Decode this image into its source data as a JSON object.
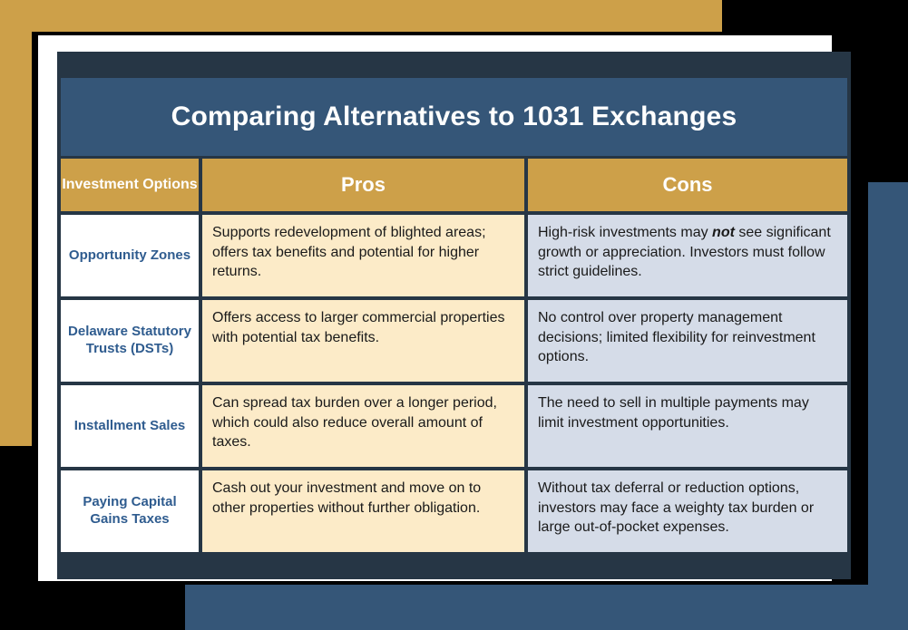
{
  "colors": {
    "gold": "#CDA049",
    "title_blue": "#355678",
    "frame_navy": "#263645",
    "pros_bg": "#FCEBC8",
    "cons_bg": "#D5DCE8",
    "option_text": "#2F5C8F",
    "card_white": "#FFFFFF"
  },
  "title": "Comparing Alternatives to 1031 Exchanges",
  "columns": {
    "option": "Investment Options",
    "pros": "Pros",
    "cons": "Cons"
  },
  "rows": [
    {
      "option": "Opportunity Zones",
      "pros": "Supports redevelopment of blighted areas; offers tax benefits and potential for higher returns.",
      "cons_before": "High-risk investments may ",
      "cons_emphasis": "not",
      "cons_after": " see significant growth or appreciation. Investors must follow strict guidelines."
    },
    {
      "option": "Delaware Statutory Trusts (DSTs)",
      "pros": "Offers access to larger commercial properties with potential tax benefits.",
      "cons_before": "No control over property management decisions; limited flexibility for reinvestment options.",
      "cons_emphasis": "",
      "cons_after": ""
    },
    {
      "option": "Installment Sales",
      "pros": "Can spread tax burden over a longer period, which could also reduce overall amount of taxes.",
      "cons_before": "The need to sell in multiple payments may limit investment opportunities.",
      "cons_emphasis": "",
      "cons_after": ""
    },
    {
      "option": "Paying Capital Gains Taxes",
      "pros": "Cash out your investment and move on to other properties without further obligation.",
      "cons_before": "Without tax deferral or reduction options, investors may face a weighty tax burden or large out-of-pocket expenses.",
      "cons_emphasis": "",
      "cons_after": ""
    }
  ]
}
